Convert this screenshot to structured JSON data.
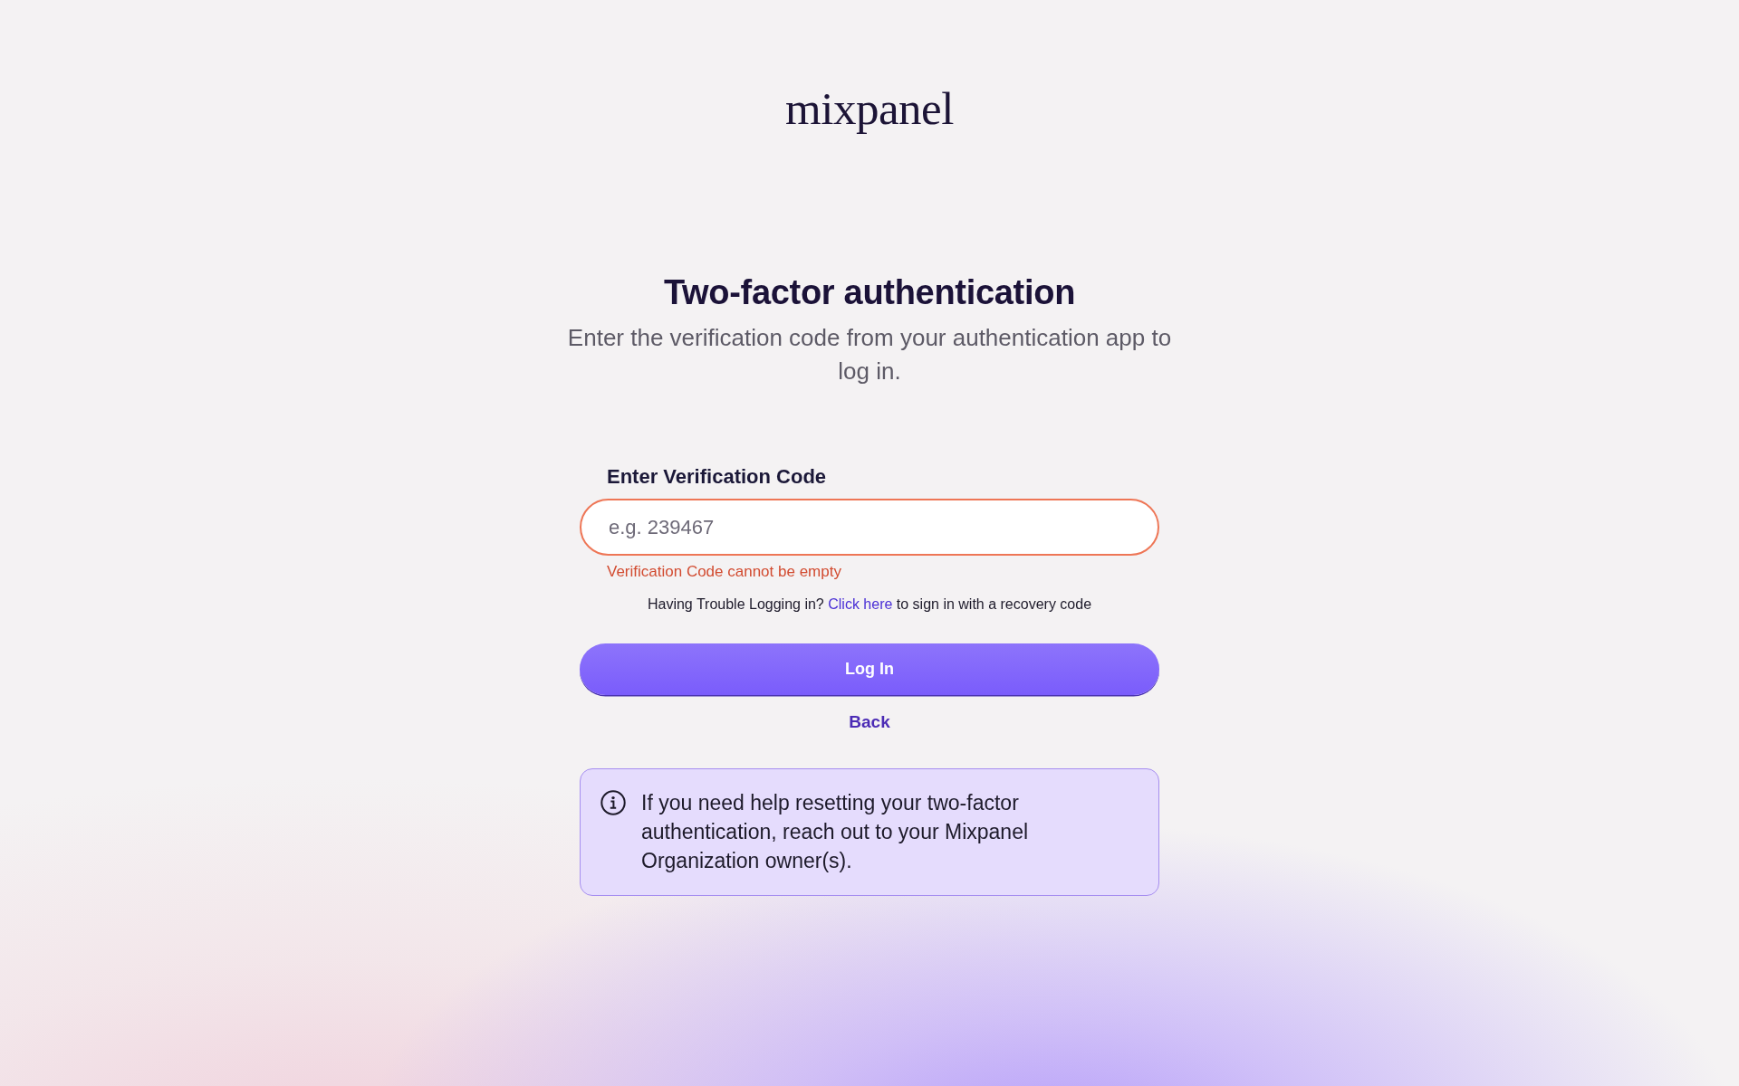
{
  "logo": {
    "text": "mixpanel"
  },
  "heading": {
    "title": "Two-factor authentication",
    "subtitle": "Enter the verification code from your authentication app to log in."
  },
  "form": {
    "field": {
      "label": "Enter Verification Code",
      "placeholder": "e.g. 239467",
      "invalid": true,
      "error": "Verification Code cannot be empty"
    },
    "help": {
      "before": "Having Trouble Logging in?",
      "link": "Click here",
      "after": "to sign in with a recovery code"
    },
    "submit": "Log In",
    "back": "Back"
  },
  "notice": {
    "text": "If you need help resetting your two-factor authentication, reach out to your Mixpanel Organization owner(s)."
  }
}
